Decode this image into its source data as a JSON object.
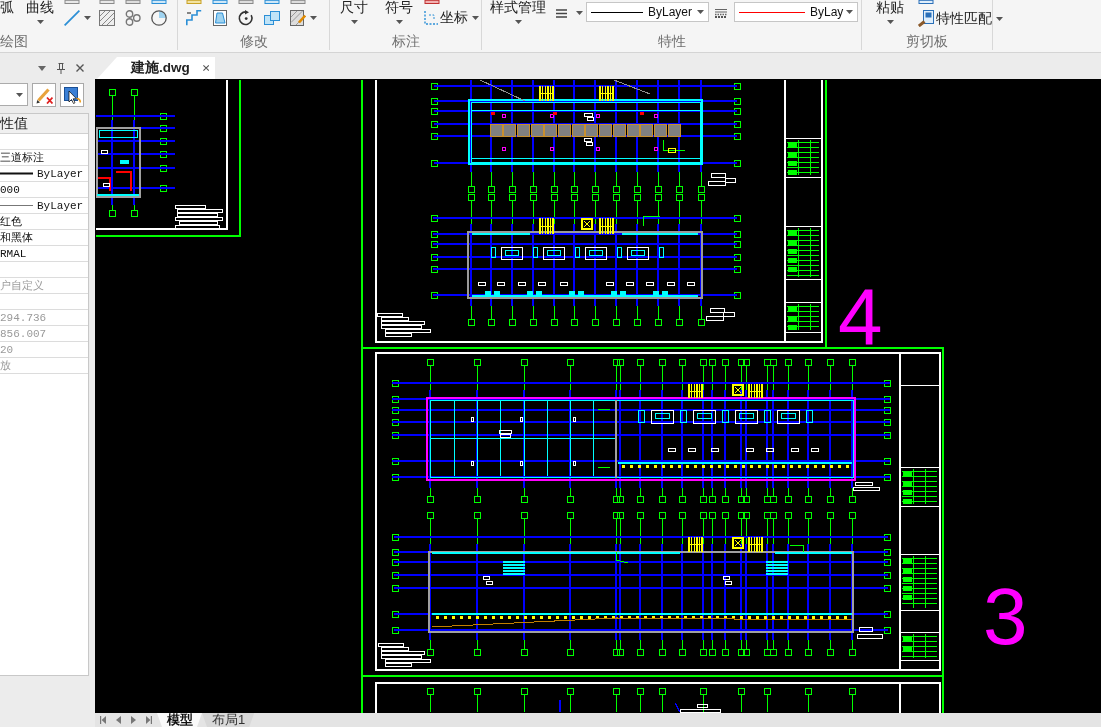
{
  "ribbon": [
    {
      "title": "绘图",
      "buttons": [
        {
          "kind": "text",
          "label": "弧"
        },
        {
          "kind": "large",
          "label": "曲线"
        }
      ]
    },
    {
      "title": "修改"
    },
    {
      "title": "标注",
      "buttons": [
        {
          "kind": "large",
          "label": "尺寸"
        },
        {
          "kind": "large",
          "label": "符号"
        },
        {
          "kind": "small",
          "label": "坐标"
        }
      ]
    },
    {
      "title": "特性",
      "buttons": [
        {
          "kind": "large",
          "label": "样式管理"
        }
      ],
      "combos": [
        {
          "value": "ByLayer",
          "color": "#000000"
        },
        {
          "value": "ByLay",
          "color": "#ff0000"
        }
      ]
    },
    {
      "title": "剪切板",
      "buttons": [
        {
          "kind": "large",
          "label": "粘贴"
        },
        {
          "kind": "small",
          "label": "特性匹配"
        }
      ]
    }
  ],
  "document_tabs": [
    {
      "label": "建施.dwg",
      "selected": true
    }
  ],
  "properties_panel": {
    "header": "性值",
    "sections": [
      {
        "rows": [
          {
            "kind": "text",
            "value": "三道标注",
            "disabled": false
          },
          {
            "kind": "linetype",
            "value": "ByLayer",
            "disabled": false
          },
          {
            "kind": "text",
            "value": "000",
            "disabled": false
          },
          {
            "kind": "lineweight",
            "value": "ByLayer",
            "disabled": false
          },
          {
            "kind": "text",
            "value": "红色",
            "disabled": false
          },
          {
            "kind": "text",
            "value": "和黑体",
            "disabled": false
          },
          {
            "kind": "text",
            "value": "RMAL",
            "disabled": false
          }
        ]
      },
      {
        "rows": [
          {
            "kind": "text",
            "value": "户自定义",
            "disabled": true
          }
        ]
      },
      {
        "rows": [
          {
            "kind": "text",
            "value": "294.736",
            "disabled": true
          },
          {
            "kind": "text",
            "value": "856.007",
            "disabled": true
          },
          {
            "kind": "text",
            "value": "20",
            "disabled": true
          },
          {
            "kind": "text",
            "value": "放",
            "disabled": true
          }
        ]
      }
    ]
  },
  "drawing": {
    "sheet_numbers": [
      "4",
      "3"
    ]
  },
  "layout_tabs": [
    {
      "label": "模型",
      "selected": true
    },
    {
      "label": "布局1",
      "selected": false
    }
  ]
}
